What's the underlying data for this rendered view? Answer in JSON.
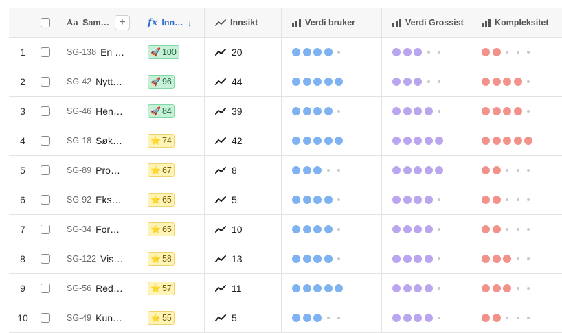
{
  "headers": {
    "name": "Sam…",
    "score": "Inn…",
    "insight": "Innsikt",
    "value_user": "Verdi bruker",
    "value_wholesaler": "Verdi Grossist",
    "complexity": "Kompleksitet",
    "add_label": "+",
    "name_icon_text": "Aa",
    "score_icon_text": "fx",
    "sort_arrow": "↓"
  },
  "colors": {
    "value_user": "#7fb2f0",
    "value_wholesaler": "#b9a6ee",
    "complexity": "#f3928a",
    "empty": "#c8c8c8"
  },
  "rows": [
    {
      "num": "1",
      "id": "SG-138",
      "title": "En …",
      "badge_icon": "rocket-icon",
      "badge_emoji": "🚀",
      "badge_color": "green",
      "score": "100",
      "insight": "20",
      "value_user": 4,
      "value_wholesaler": 3,
      "complexity": 2
    },
    {
      "num": "2",
      "id": "SG-42",
      "title": "Nytt…",
      "badge_icon": "rocket-icon",
      "badge_emoji": "🚀",
      "badge_color": "green",
      "score": "96",
      "insight": "44",
      "value_user": 5,
      "value_wholesaler": 3,
      "complexity": 4
    },
    {
      "num": "3",
      "id": "SG-46",
      "title": "Hent…",
      "badge_icon": "rocket-icon",
      "badge_emoji": "🚀",
      "badge_color": "green",
      "score": "84",
      "insight": "39",
      "value_user": 4,
      "value_wholesaler": 4,
      "complexity": 4
    },
    {
      "num": "4",
      "id": "SG-18",
      "title": "Søke…",
      "badge_icon": "star-icon",
      "badge_emoji": "⭐",
      "badge_color": "yellow",
      "score": "74",
      "insight": "42",
      "value_user": 5,
      "value_wholesaler": 5,
      "complexity": 5
    },
    {
      "num": "5",
      "id": "SG-89",
      "title": "Prod…",
      "badge_icon": "star-icon",
      "badge_emoji": "⭐",
      "badge_color": "yellow",
      "score": "67",
      "insight": "8",
      "value_user": 3,
      "value_wholesaler": 5,
      "complexity": 2
    },
    {
      "num": "6",
      "id": "SG-92",
      "title": "Eks…",
      "badge_icon": "star-icon",
      "badge_emoji": "⭐",
      "badge_color": "yellow",
      "score": "65",
      "insight": "5",
      "value_user": 4,
      "value_wholesaler": 4,
      "complexity": 2
    },
    {
      "num": "7",
      "id": "SG-34",
      "title": "Forv…",
      "badge_icon": "star-icon",
      "badge_emoji": "⭐",
      "badge_color": "yellow",
      "score": "65",
      "insight": "10",
      "value_user": 4,
      "value_wholesaler": 4,
      "complexity": 2
    },
    {
      "num": "8",
      "id": "SG-122",
      "title": "Vis…",
      "badge_icon": "star-icon",
      "badge_emoji": "⭐",
      "badge_color": "yellow",
      "score": "58",
      "insight": "13",
      "value_user": 4,
      "value_wholesaler": 4,
      "complexity": 3
    },
    {
      "num": "9",
      "id": "SG-56",
      "title": "Red…",
      "badge_icon": "star-icon",
      "badge_emoji": "⭐",
      "badge_color": "yellow",
      "score": "57",
      "insight": "11",
      "value_user": 5,
      "value_wholesaler": 4,
      "complexity": 3
    },
    {
      "num": "10",
      "id": "SG-49",
      "title": "Kun…",
      "badge_icon": "star-icon",
      "badge_emoji": "⭐",
      "badge_color": "yellow",
      "score": "55",
      "insight": "5",
      "value_user": 3,
      "value_wholesaler": 4,
      "complexity": 2
    }
  ]
}
